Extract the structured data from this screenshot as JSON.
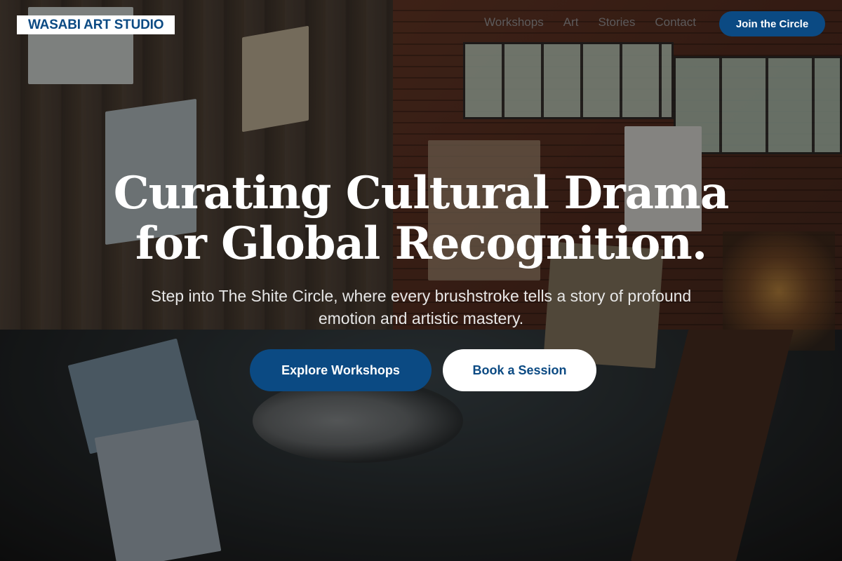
{
  "brand": {
    "logo_text": "WASABI ART STUDIO",
    "accent_color": "#0b4a83"
  },
  "nav": {
    "items": [
      {
        "label": "Workshops"
      },
      {
        "label": "Art"
      },
      {
        "label": "Stories"
      },
      {
        "label": "Contact"
      }
    ],
    "join_label": "Join the Circle"
  },
  "hero": {
    "title_line1": "Curating Cultural Drama",
    "title_line2": "for Global Recognition.",
    "subtitle": "Step into The Shite Circle, where every brushstroke tells a story of profound emotion and artistic mastery.",
    "primary_cta": "Explore Workshops",
    "secondary_cta": "Book a Session"
  }
}
